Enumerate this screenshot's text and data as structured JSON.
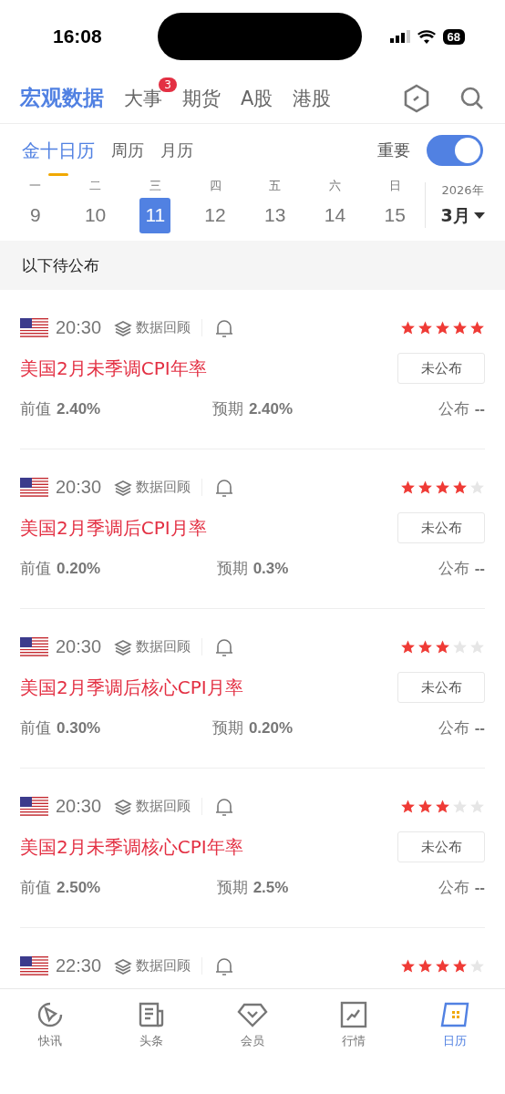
{
  "status_bar": {
    "time": "16:08",
    "battery": "68"
  },
  "top_tabs": [
    {
      "label": "宏观数据",
      "selected": true
    },
    {
      "label": "大事",
      "selected": false,
      "badge": "3"
    },
    {
      "label": "期货",
      "selected": false
    },
    {
      "label": "A股",
      "selected": false
    },
    {
      "label": "港股",
      "selected": false
    }
  ],
  "calendar_tabs": [
    {
      "label": "金十日历",
      "selected": true
    },
    {
      "label": "周历",
      "selected": false
    },
    {
      "label": "月历",
      "selected": false
    }
  ],
  "important_toggle": {
    "label": "重要",
    "on": true
  },
  "week": [
    {
      "weekday": "一",
      "date": "9",
      "selected": false
    },
    {
      "weekday": "二",
      "date": "10",
      "selected": false
    },
    {
      "weekday": "三",
      "date": "11",
      "selected": true
    },
    {
      "weekday": "四",
      "date": "12",
      "selected": false
    },
    {
      "weekday": "五",
      "date": "13",
      "selected": false
    },
    {
      "weekday": "六",
      "date": "14",
      "selected": false
    },
    {
      "weekday": "日",
      "date": "15",
      "selected": false
    }
  ],
  "month_picker": {
    "year": "2026年",
    "month": "3月"
  },
  "section_header": "以下待公布",
  "events": [
    {
      "time": "20:30",
      "review": "数据回顾",
      "stars": 5,
      "title": "美国2月未季调CPI年率",
      "status": "未公布",
      "previous_label": "前值",
      "previous": "2.40%",
      "forecast_label": "预期",
      "forecast": "2.40%",
      "actual_label": "公布",
      "actual": "--"
    },
    {
      "time": "20:30",
      "review": "数据回顾",
      "stars": 4,
      "title": "美国2月季调后CPI月率",
      "status": "未公布",
      "previous_label": "前值",
      "previous": "0.20%",
      "forecast_label": "预期",
      "forecast": "0.3%",
      "actual_label": "公布",
      "actual": "--"
    },
    {
      "time": "20:30",
      "review": "数据回顾",
      "stars": 3,
      "title": "美国2月季调后核心CPI月率",
      "status": "未公布",
      "previous_label": "前值",
      "previous": "0.30%",
      "forecast_label": "预期",
      "forecast": "0.20%",
      "actual_label": "公布",
      "actual": "--"
    },
    {
      "time": "20:30",
      "review": "数据回顾",
      "stars": 3,
      "title": "美国2月未季调核心CPI年率",
      "status": "未公布",
      "previous_label": "前值",
      "previous": "2.50%",
      "forecast_label": "预期",
      "forecast": "2.5%",
      "actual_label": "公布",
      "actual": "--"
    },
    {
      "time": "22:30",
      "review": "数据回顾",
      "stars": 4
    }
  ],
  "bottom_tabs": [
    {
      "label": "快讯",
      "selected": false
    },
    {
      "label": "头条",
      "selected": false
    },
    {
      "label": "会员",
      "selected": false
    },
    {
      "label": "行情",
      "selected": false
    },
    {
      "label": "日历",
      "selected": true
    }
  ]
}
